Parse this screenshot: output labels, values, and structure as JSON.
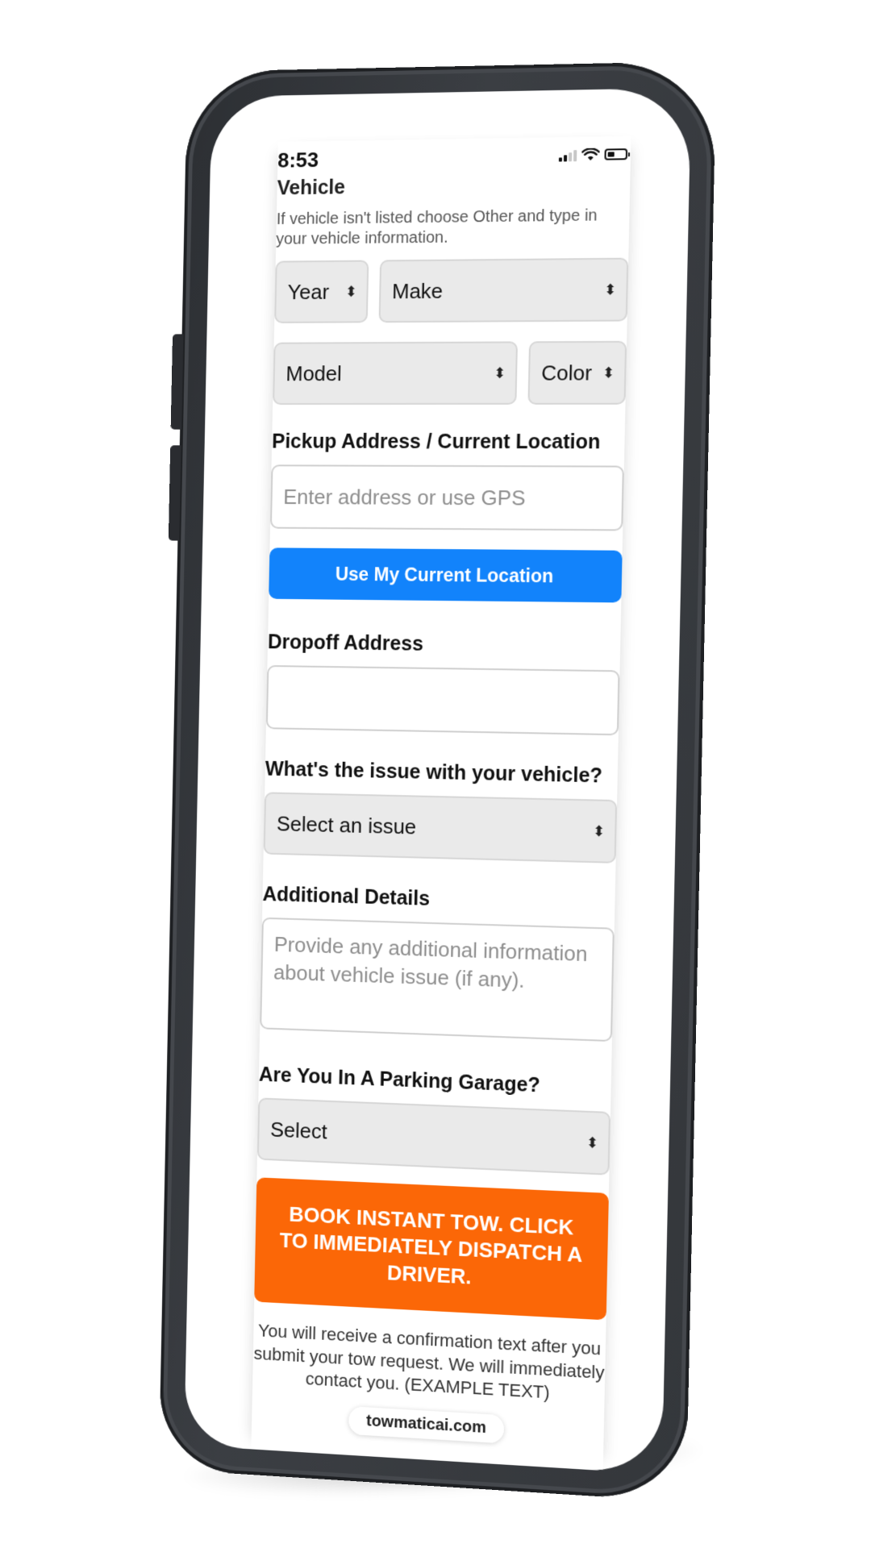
{
  "status_bar": {
    "time": "8:53"
  },
  "vehicle": {
    "title": "Vehicle",
    "helper": "If vehicle isn't listed choose Other and type in your vehicle information.",
    "year_label": "Year",
    "make_label": "Make",
    "model_label": "Model",
    "color_label": "Color"
  },
  "pickup": {
    "label": "Pickup Address / Current Location",
    "placeholder": "Enter address or use GPS",
    "location_button": "Use My Current Location"
  },
  "dropoff": {
    "label": "Dropoff Address",
    "value": ""
  },
  "issue": {
    "label": "What's the issue with your vehicle?",
    "selected": "Select an issue"
  },
  "details": {
    "label": "Additional Details",
    "placeholder": "Provide any additional information about vehicle issue (if any)."
  },
  "garage": {
    "label": "Are You In A Parking Garage?",
    "selected": "Select"
  },
  "book_button": "BOOK INSTANT TOW. CLICK TO IMMEDIATELY DISPATCH A DRIVER.",
  "footer_note": "You will receive a confirmation text after you submit your tow request. We will immediately contact you. (EXAMPLE TEXT)",
  "url_bar": {
    "domain": "towmaticai.com"
  },
  "colors": {
    "primary_blue": "#1283fb",
    "cta_orange": "#fb6707",
    "frame": "#34373b"
  }
}
